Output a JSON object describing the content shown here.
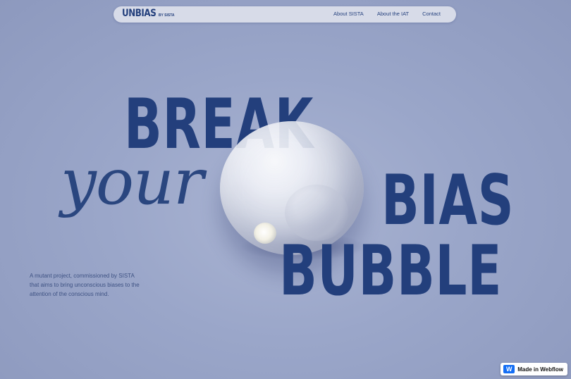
{
  "nav": {
    "logo": "UNBIAS",
    "logo_sub": "BY SISTA",
    "links": [
      "About SISTA",
      "About the IAT",
      "Contact"
    ]
  },
  "hero": {
    "line1": "BREAK",
    "line2": "your",
    "line3": "BIAS",
    "line4": "BUBBLE"
  },
  "description": "A mutant project, commissioned by SISTA that aims to bring unconscious biases to the attention of the conscious mind.",
  "badge": {
    "icon": "webflow-logo-icon",
    "icon_glyph": "W",
    "label": "Made in Webflow"
  },
  "colors": {
    "background": "#9aa6c9",
    "text": "#233f7c",
    "badge_brand": "#146ef5"
  }
}
